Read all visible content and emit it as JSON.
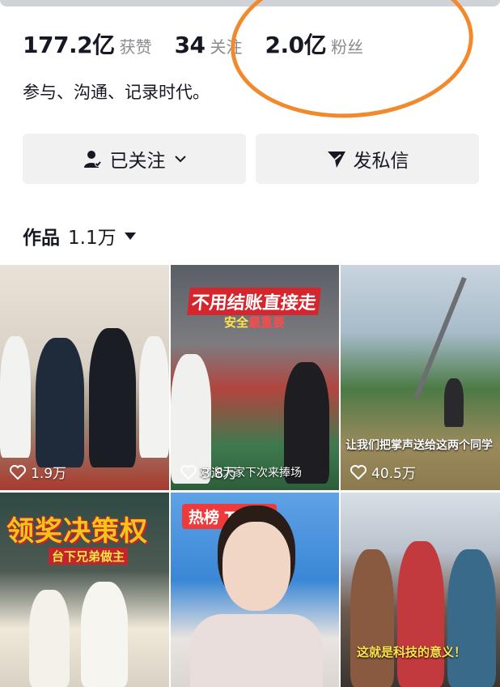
{
  "stats": [
    {
      "value": "177.2亿",
      "label": "获赞"
    },
    {
      "value": "34",
      "label": "关注"
    },
    {
      "value": "2.0亿",
      "label": "粉丝"
    }
  ],
  "bio": "参与、沟通、记录时代。",
  "buttons": {
    "follow_label": "已关注",
    "message_label": "发私信"
  },
  "works": {
    "label": "作品",
    "count": "1.1万"
  },
  "videos": [
    {
      "likes": "1.9万"
    },
    {
      "likes": "3.8万",
      "title": "不用结账直接走",
      "subtitle_a": "安全",
      "subtitle_b": "最重要",
      "caption": "欢迎大家下次来捧场"
    },
    {
      "likes": "40.5万",
      "caption": "让我们把掌声送给这两个同学"
    },
    {
      "title": "领奖决策权",
      "subtitle": "台下兄弟做主"
    },
    {
      "badge": "热榜 TOP1"
    },
    {
      "caption": "这就是科技的意义！"
    }
  ],
  "annotation_color": "#f2892d"
}
